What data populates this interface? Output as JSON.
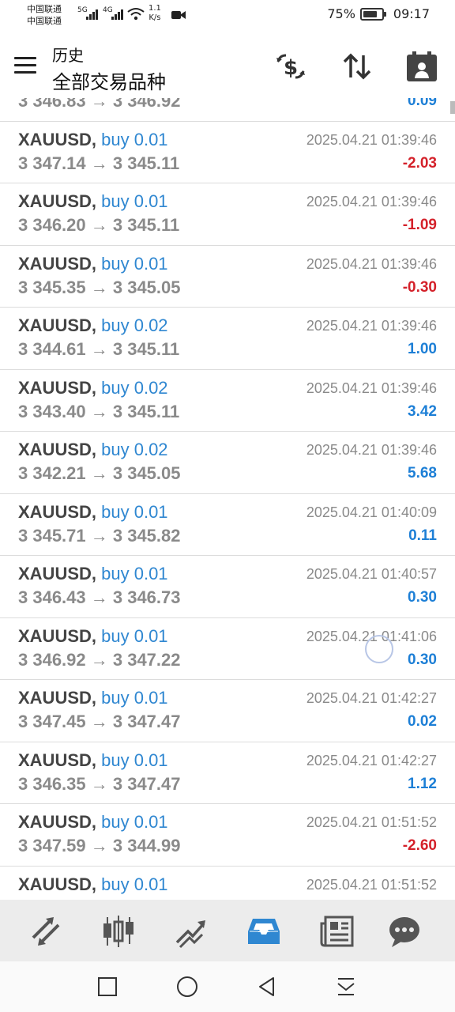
{
  "status": {
    "carrier1": "中国联通",
    "carrier2": "中国联通",
    "sig1": "5G",
    "sig2": "4G",
    "speed_value": "1.1",
    "speed_unit": "K/s",
    "battery": "75%",
    "battery_level": 0.75,
    "time": "09:17"
  },
  "header": {
    "title": "历史",
    "subtitle": "全部交易品种"
  },
  "trades": [
    {
      "symbol": "",
      "side": "",
      "time": "",
      "prices": "3 346.83 → 3 346.92",
      "profit": "0.09",
      "sign": "pos"
    },
    {
      "symbol": "XAUUSD,",
      "side": "buy 0.01",
      "time": "2025.04.21 01:39:46",
      "prices": "3 347.14 → 3 345.11",
      "profit": "-2.03",
      "sign": "neg"
    },
    {
      "symbol": "XAUUSD,",
      "side": "buy 0.01",
      "time": "2025.04.21 01:39:46",
      "prices": "3 346.20 → 3 345.11",
      "profit": "-1.09",
      "sign": "neg"
    },
    {
      "symbol": "XAUUSD,",
      "side": "buy 0.01",
      "time": "2025.04.21 01:39:46",
      "prices": "3 345.35 → 3 345.05",
      "profit": "-0.30",
      "sign": "neg"
    },
    {
      "symbol": "XAUUSD,",
      "side": "buy 0.02",
      "time": "2025.04.21 01:39:46",
      "prices": "3 344.61 → 3 345.11",
      "profit": "1.00",
      "sign": "pos"
    },
    {
      "symbol": "XAUUSD,",
      "side": "buy 0.02",
      "time": "2025.04.21 01:39:46",
      "prices": "3 343.40 → 3 345.11",
      "profit": "3.42",
      "sign": "pos"
    },
    {
      "symbol": "XAUUSD,",
      "side": "buy 0.02",
      "time": "2025.04.21 01:39:46",
      "prices": "3 342.21 → 3 345.05",
      "profit": "5.68",
      "sign": "pos"
    },
    {
      "symbol": "XAUUSD,",
      "side": "buy 0.01",
      "time": "2025.04.21 01:40:09",
      "prices": "3 345.71 → 3 345.82",
      "profit": "0.11",
      "sign": "pos"
    },
    {
      "symbol": "XAUUSD,",
      "side": "buy 0.01",
      "time": "2025.04.21 01:40:57",
      "prices": "3 346.43 → 3 346.73",
      "profit": "0.30",
      "sign": "pos"
    },
    {
      "symbol": "XAUUSD,",
      "side": "buy 0.01",
      "time": "2025.04.21 01:41:06",
      "prices": "3 346.92 → 3 347.22",
      "profit": "0.30",
      "sign": "pos"
    },
    {
      "symbol": "XAUUSD,",
      "side": "buy 0.01",
      "time": "2025.04.21 01:42:27",
      "prices": "3 347.45 → 3 347.47",
      "profit": "0.02",
      "sign": "pos"
    },
    {
      "symbol": "XAUUSD,",
      "side": "buy 0.01",
      "time": "2025.04.21 01:42:27",
      "prices": "3 346.35 → 3 347.47",
      "profit": "1.12",
      "sign": "pos"
    },
    {
      "symbol": "XAUUSD,",
      "side": "buy 0.01",
      "time": "2025.04.21 01:51:52",
      "prices": "3 347.59 → 3 344.99",
      "profit": "-2.60",
      "sign": "neg"
    },
    {
      "symbol": "XAUUSD,",
      "side": "buy 0.01",
      "time": "2025.04.21 01:51:52",
      "prices": "",
      "profit": "",
      "sign": "pos"
    }
  ],
  "bottom_nav": [
    {
      "icon": "quotes-icon",
      "active": false
    },
    {
      "icon": "chart-icon",
      "active": false
    },
    {
      "icon": "trade-icon",
      "active": false
    },
    {
      "icon": "history-icon",
      "active": true
    },
    {
      "icon": "news-icon",
      "active": false
    },
    {
      "icon": "messages-icon",
      "active": false
    }
  ],
  "colors": {
    "accent": "#2f87d1",
    "profit_positive": "#1d7fd6",
    "profit_negative": "#d4212a",
    "nav_icon": "#555555"
  }
}
